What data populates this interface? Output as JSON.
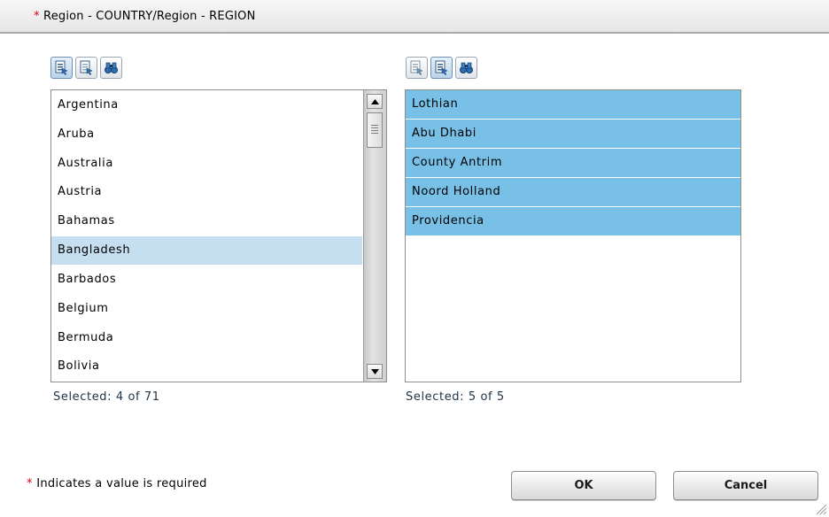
{
  "header": {
    "required_marker": "*",
    "title": "Region - COUNTRY/Region - REGION"
  },
  "toolbar_icons": [
    "select-all-icon",
    "deselect-all-icon",
    "find-icon"
  ],
  "available_list": {
    "items": [
      "Argentina",
      "Aruba",
      "Australia",
      "Austria",
      "Bahamas",
      "Bangladesh",
      "Barbados",
      "Belgium",
      "Bermuda",
      "Bolivia"
    ],
    "highlighted": "Bangladesh",
    "selected_text": "Selected: 4 of 71"
  },
  "selected_list": {
    "items": [
      "Lothian",
      "Abu Dhabi",
      "County Antrim",
      "Noord Holland",
      "Providencia"
    ],
    "selected_text": "Selected: 5 of 5"
  },
  "footer": {
    "required_marker": "*",
    "required_note": "Indicates a value is required",
    "ok_label": "OK",
    "cancel_label": "Cancel"
  },
  "colors": {
    "required_star": "#d0021b",
    "selected_row": "#79c0e7",
    "highlighted_row": "#c6dff0"
  }
}
